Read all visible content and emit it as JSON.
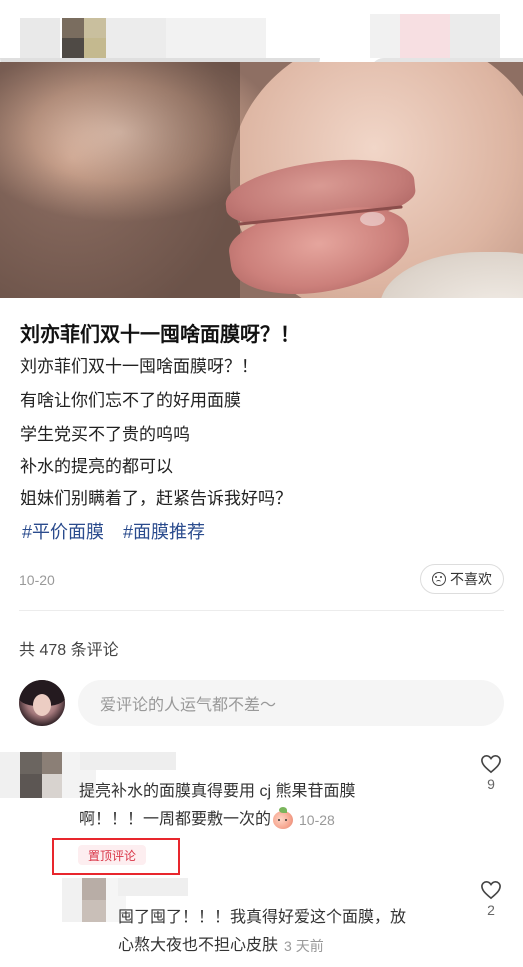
{
  "post": {
    "title": "刘亦菲们双十一囤啥面膜呀？！",
    "lines": [
      "刘亦菲们双十一囤啥面膜呀？！",
      "有啥让你们忘不了的好用面膜",
      "学生党买不了贵的呜呜",
      "补水的提亮的都可以",
      "姐妹们别瞒着了，赶紧告诉我好吗？"
    ],
    "tags": [
      "#平价面膜",
      "#面膜推荐"
    ],
    "date": "10-20",
    "dislike_label": "不喜欢"
  },
  "comments_header": {
    "count_text": "共 478 条评论"
  },
  "comment_input": {
    "placeholder": "爱评论的人运气都不差～"
  },
  "comments": [
    {
      "text_line1": "提亮补水的面膜真得要用 cj 熊果苷面膜",
      "text_line2": "啊！！！一周都要敷一次的",
      "emoji": "peach-face",
      "date": "10-28",
      "badge": "置顶评论",
      "likes": "9"
    },
    {
      "text_line1": "囤了囤了！！！我真得好爱这个面膜，放",
      "text_line2": "心熬大夜也不担心皮肤",
      "date": "3 天前",
      "likes": "2"
    }
  ],
  "colors": {
    "tag": "#2a4b8d",
    "pinned_border": "#e8262d",
    "badge_text": "#d93446",
    "badge_bg": "#fdeef0"
  }
}
